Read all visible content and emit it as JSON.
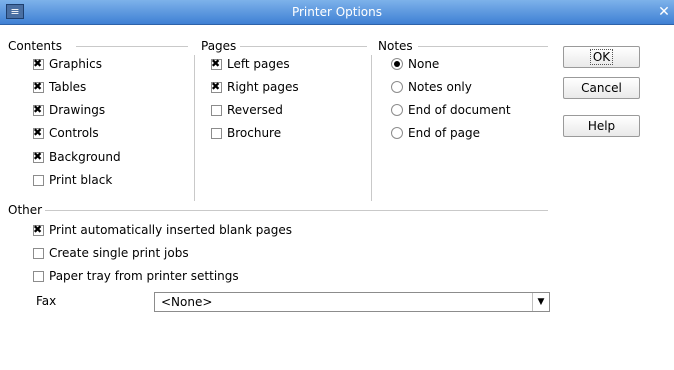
{
  "window": {
    "title": "Printer Options",
    "close_glyph": "✕",
    "icon_name": "app-icon"
  },
  "contents": {
    "title": "Contents",
    "items": [
      {
        "label": "Graphics",
        "checked": true
      },
      {
        "label": "Tables",
        "checked": true
      },
      {
        "label": "Drawings",
        "checked": true
      },
      {
        "label": "Controls",
        "checked": true
      },
      {
        "label": "Background",
        "checked": true
      },
      {
        "label": "Print black",
        "checked": false
      }
    ]
  },
  "pages": {
    "title": "Pages",
    "items": [
      {
        "label": "Left pages",
        "checked": true
      },
      {
        "label": "Right pages",
        "checked": true
      },
      {
        "label": "Reversed",
        "checked": false
      },
      {
        "label": "Brochure",
        "checked": false
      }
    ]
  },
  "notes": {
    "title": "Notes",
    "options": [
      {
        "label": "None",
        "selected": true
      },
      {
        "label": "Notes only",
        "selected": false
      },
      {
        "label": "End of document",
        "selected": false
      },
      {
        "label": "End of page",
        "selected": false
      }
    ]
  },
  "other": {
    "title": "Other",
    "items": [
      {
        "label": "Print automatically inserted blank pages",
        "checked": true
      },
      {
        "label": "Create single print jobs",
        "checked": false
      },
      {
        "label": "Paper tray from printer settings",
        "checked": false
      }
    ],
    "fax_label": "Fax",
    "fax_value": "<None>"
  },
  "buttons": {
    "ok": "OK",
    "cancel": "Cancel",
    "help": "Help"
  },
  "colors": {
    "titlebar_top": "#7db2ea",
    "titlebar_bottom": "#3f80d4"
  }
}
